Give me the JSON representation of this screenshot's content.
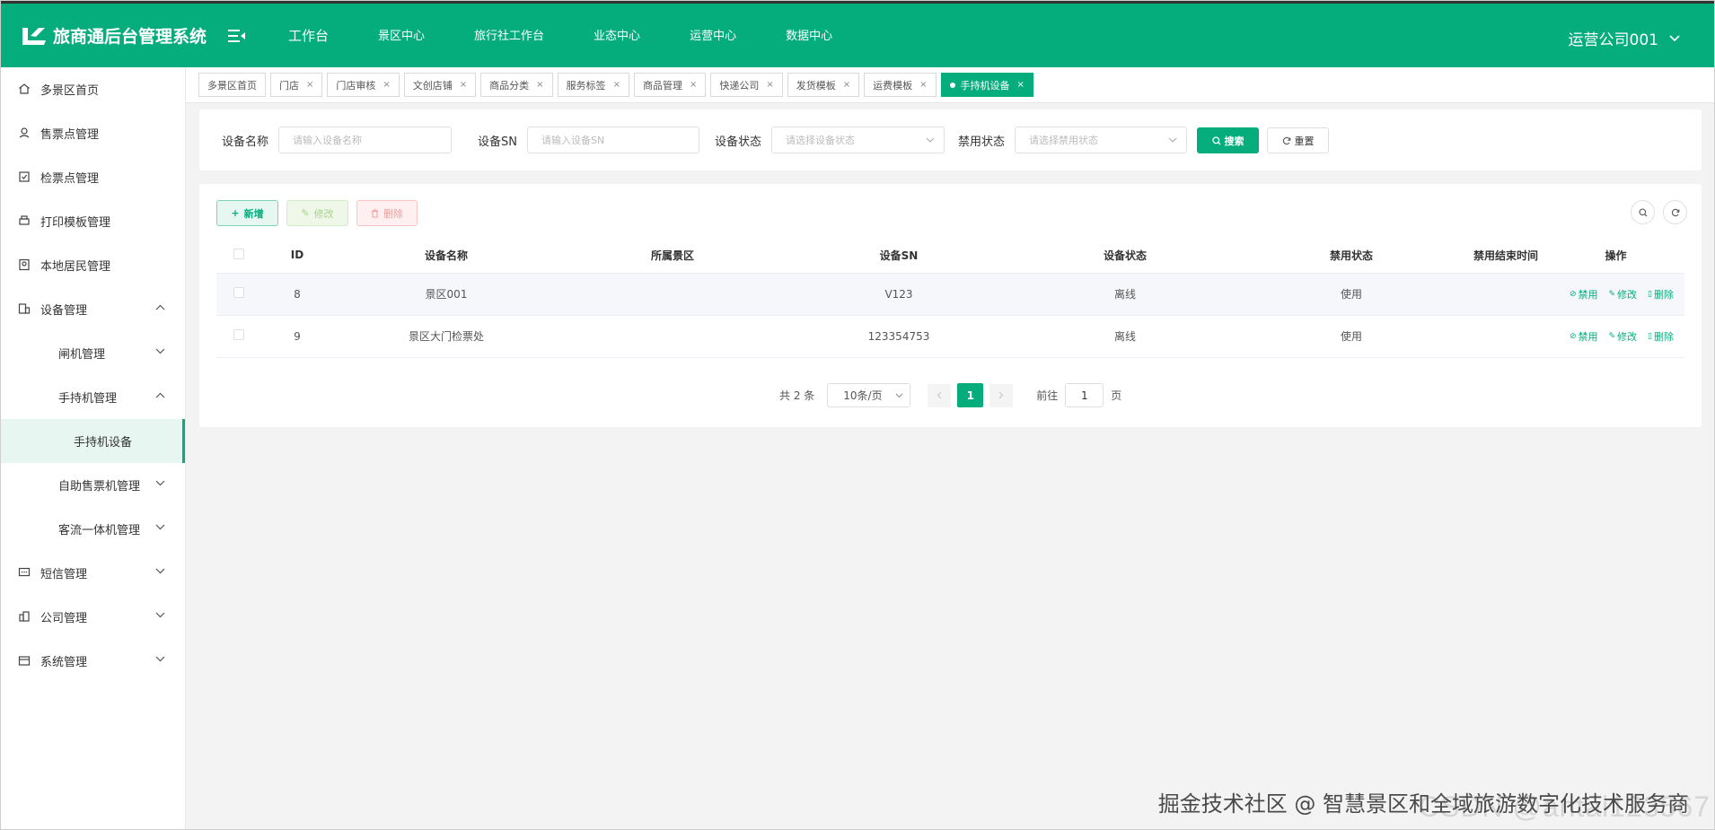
{
  "header": {
    "title": "旅商通后台管理系统",
    "nav": [
      "工作台",
      "景区中心",
      "旅行社工作台",
      "业态中心",
      "运营中心",
      "数据中心"
    ],
    "user": "运营公司001",
    "brand_color": "#05ad7d"
  },
  "sidebar": {
    "items": [
      {
        "label": "多景区首页",
        "icon": "home-icon"
      },
      {
        "label": "售票点管理",
        "icon": "ticket-icon"
      },
      {
        "label": "检票点管理",
        "icon": "checkin-icon"
      },
      {
        "label": "打印模板管理",
        "icon": "printer-icon"
      },
      {
        "label": "本地居民管理",
        "icon": "resident-icon"
      },
      {
        "label": "设备管理",
        "icon": "device-icon"
      },
      {
        "label": "闸机管理"
      },
      {
        "label": "手持机管理"
      },
      {
        "label": "手持机设备"
      },
      {
        "label": "自助售票机管理"
      },
      {
        "label": "客流一体机管理"
      },
      {
        "label": "短信管理",
        "icon": "sms-icon"
      },
      {
        "label": "公司管理",
        "icon": "company-icon"
      },
      {
        "label": "系统管理",
        "icon": "system-icon"
      }
    ]
  },
  "tabs": [
    {
      "label": "多景区首页"
    },
    {
      "label": "门店"
    },
    {
      "label": "门店审核"
    },
    {
      "label": "文创店铺"
    },
    {
      "label": "商品分类"
    },
    {
      "label": "服务标签"
    },
    {
      "label": "商品管理"
    },
    {
      "label": "快递公司"
    },
    {
      "label": "发货模板"
    },
    {
      "label": "运费模板"
    },
    {
      "label": "手持机设备"
    }
  ],
  "search": {
    "device_name_label": "设备名称",
    "device_name_placeholder": "请输入设备名称",
    "device_sn_label": "设备SN",
    "device_sn_placeholder": "请输入设备SN",
    "device_status_label": "设备状态",
    "device_status_placeholder": "请选择设备状态",
    "disable_status_label": "禁用状态",
    "disable_status_placeholder": "请选择禁用状态",
    "search_btn": "搜索",
    "reset_btn": "重置"
  },
  "toolbar": {
    "add": "新增",
    "edit": "修改",
    "delete": "删除"
  },
  "table": {
    "columns": [
      "ID",
      "设备名称",
      "所属景区",
      "设备SN",
      "设备状态",
      "禁用状态",
      "禁用结束时间",
      "操作"
    ],
    "rows": [
      {
        "id": "8",
        "name": "景区001",
        "scenic": "",
        "sn": "V123",
        "status": "离线",
        "disable": "使用",
        "end_time": ""
      },
      {
        "id": "9",
        "name": "景区大门检票处",
        "scenic": "",
        "sn": "123354753",
        "status": "离线",
        "disable": "使用",
        "end_time": ""
      }
    ],
    "ops": {
      "disable": "禁用",
      "edit": "修改",
      "delete": "删除"
    }
  },
  "pagination": {
    "total": "共 2 条",
    "page_size": "10条/页",
    "current": "1",
    "goto_prefix": "前往",
    "goto_value": "1",
    "goto_suffix": "页"
  },
  "watermark": {
    "text": "掘金技术社区 @ 智慧景区和全域旅游数字化技术服务商",
    "faint": "CSDN @antai123567"
  }
}
